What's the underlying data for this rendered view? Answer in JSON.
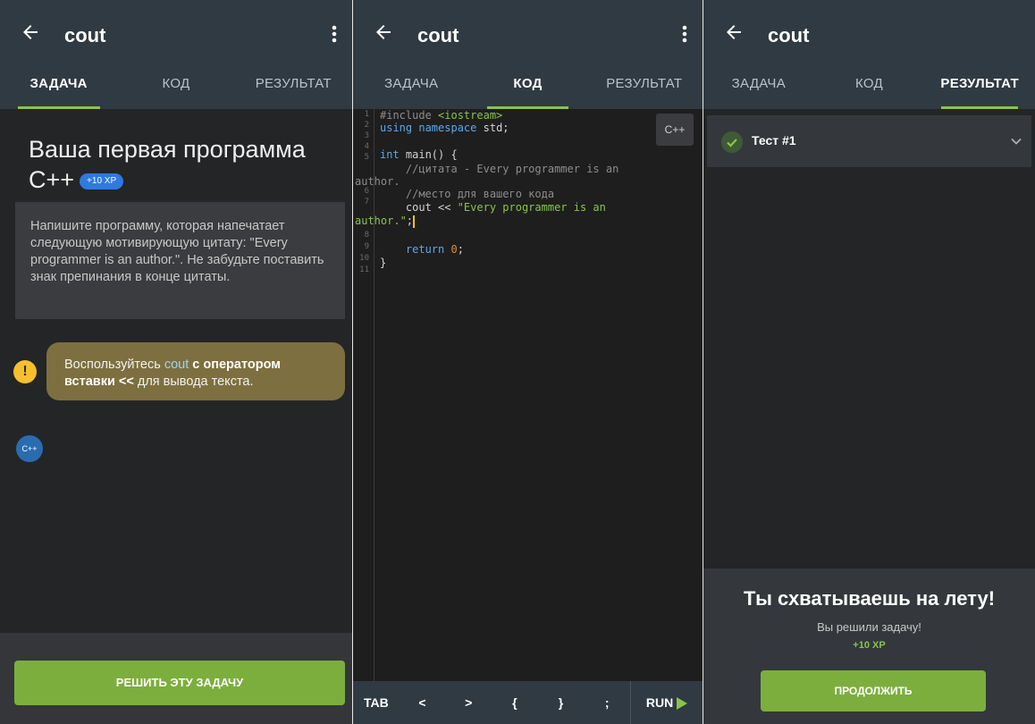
{
  "panels": [
    {
      "title": "cout",
      "tabs": [
        "ЗАДАЧА",
        "КОД",
        "РЕЗУЛЬТАТ"
      ],
      "active_tab": 0
    },
    {
      "title": "cout",
      "tabs": [
        "ЗАДАЧА",
        "КОД",
        "РЕЗУЛЬТАТ"
      ],
      "active_tab": 1
    },
    {
      "title": "cout",
      "tabs": [
        "ЗАДАЧА",
        "КОД",
        "РЕЗУЛЬТАТ"
      ],
      "active_tab": 2
    }
  ],
  "task": {
    "title": "Ваша первая программа C++",
    "xp_badge": "+10 XP",
    "description": "Напишите программу, которая напечатает следующую мотивирующую цитату: \"Every programmer is an author.\". Не забудьте поставить знак препинания в конце цитаты.",
    "hint_before": "Воспользуйтесь ",
    "hint_code": "cout",
    "hint_bold": " с оператором вставки <<",
    "hint_after": " для вывода текста.",
    "warn_glyph": "!",
    "avatar_label": "C++",
    "solve_button": "РЕШИТЬ ЭТУ ЗАДАЧУ"
  },
  "editor": {
    "lang_button": "C++",
    "line_numbers": [
      "1",
      "2",
      "3",
      "4",
      "5",
      "6",
      "7",
      "8",
      "9",
      "10",
      "11"
    ],
    "code": {
      "l1a": "#include ",
      "l1b": "<iostream>",
      "l2a": "using ",
      "l2b": "namespace",
      "l2c": " std;",
      "l4a": "int",
      "l4b": " main() {",
      "l5": "    //цитата - Every programmer is an",
      "l5w": "author.",
      "l6": "    //место для вашего кода",
      "l7a": "    cout << ",
      "l7b": "\"Every programmer is an",
      "l7w": "author.\"",
      "l7c": ";",
      "l9a": "    return ",
      "l9b": "0",
      "l9c": ";",
      "l10": "}"
    },
    "keys": [
      "TAB",
      "<",
      ">",
      "{",
      "}",
      ";"
    ],
    "run_label": "RUN"
  },
  "result": {
    "test_label": "Тест #1",
    "title": "Ты схватываешь на лету!",
    "subtitle": "Вы решили задачу!",
    "xp": "+10 XP",
    "continue_button": "ПРОДОЛЖИТЬ"
  },
  "colors": {
    "accent": "#8bc34a",
    "appbar": "#2f3a43",
    "button": "#7cae3d",
    "badge": "#2e7ae0"
  }
}
